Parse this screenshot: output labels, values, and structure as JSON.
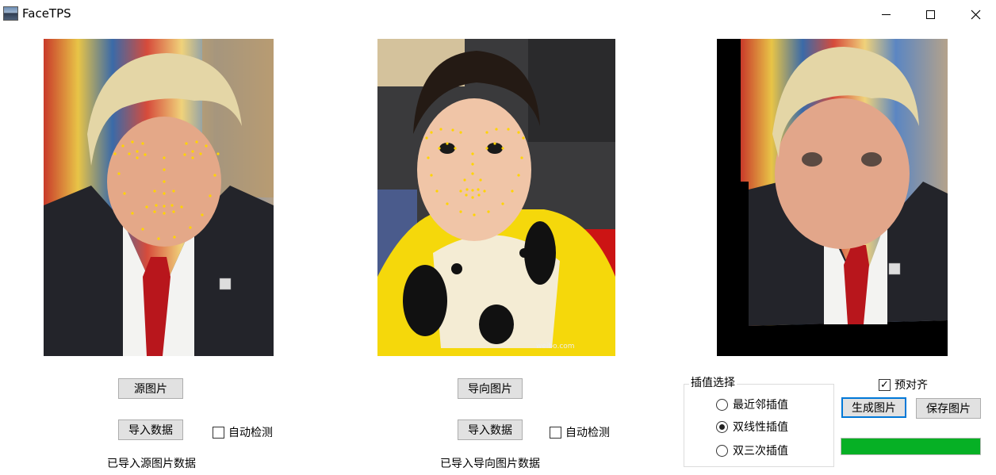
{
  "window": {
    "title": "FaceTPS",
    "controls": {
      "minimize": "minimize-icon",
      "maximize": "maximize-icon",
      "close": "close-icon"
    }
  },
  "source_panel": {
    "load_button": "源图片",
    "import_button": "导入数据",
    "auto_detect_label": "自动检测",
    "auto_detect_checked": false,
    "status": "已导入源图片数据"
  },
  "guide_panel": {
    "load_button": "导向图片",
    "import_button": "导入数据",
    "auto_detect_label": "自动检测",
    "auto_detect_checked": false,
    "status": "已导入导向图片数据"
  },
  "interpolation": {
    "group_label": "插值选择",
    "options": [
      "最近邻插值",
      "双线性插值",
      "双三次插值"
    ],
    "selected": "双线性插值"
  },
  "controls": {
    "pre_align_label": "预对齐",
    "pre_align_checked": true,
    "generate_button": "生成图片",
    "save_button": "保存图片",
    "progress": 1.0
  },
  "colors": {
    "landmark": "#ffd400",
    "progress": "#06b025",
    "button_face": "#e1e1e1",
    "default_button_border": "#0078d7"
  }
}
